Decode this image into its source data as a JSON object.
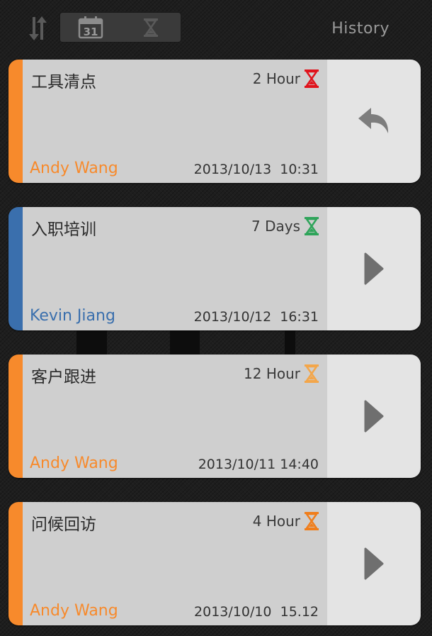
{
  "header": {
    "calendar_day": "31",
    "history_label": "History"
  },
  "colors": {
    "orange": "#f78a2c",
    "blue": "#3a6fad",
    "hourglass_red": "#e0131c",
    "hourglass_green": "#2fa45a",
    "hourglass_light_orange": "#f3a64a",
    "hourglass_orange": "#f07e1c"
  },
  "tasks": [
    {
      "title": "工具清点",
      "duration": "2 Hour",
      "hourglass_icon": "hourglass-red-icon",
      "assignee": "Andy Wang",
      "timestamp": "2013/10/13  10:31",
      "action_icon": "reply-icon"
    },
    {
      "title": "入职培训",
      "duration": "7 Days",
      "hourglass_icon": "hourglass-green-icon",
      "assignee": "Kevin Jiang",
      "timestamp": "2013/10/12  16:31",
      "action_icon": "play-arrow-icon"
    },
    {
      "title": "客户跟进",
      "duration": "12 Hour",
      "hourglass_icon": "hourglass-light-orange-icon",
      "assignee": "Andy Wang",
      "timestamp": "2013/10/11 14:40",
      "action_icon": "play-arrow-icon"
    },
    {
      "title": "问候回访",
      "duration": "4 Hour",
      "hourglass_icon": "hourglass-orange-icon",
      "assignee": "Andy Wang",
      "timestamp": "2013/10/10  15.12",
      "action_icon": "play-arrow-icon"
    }
  ]
}
